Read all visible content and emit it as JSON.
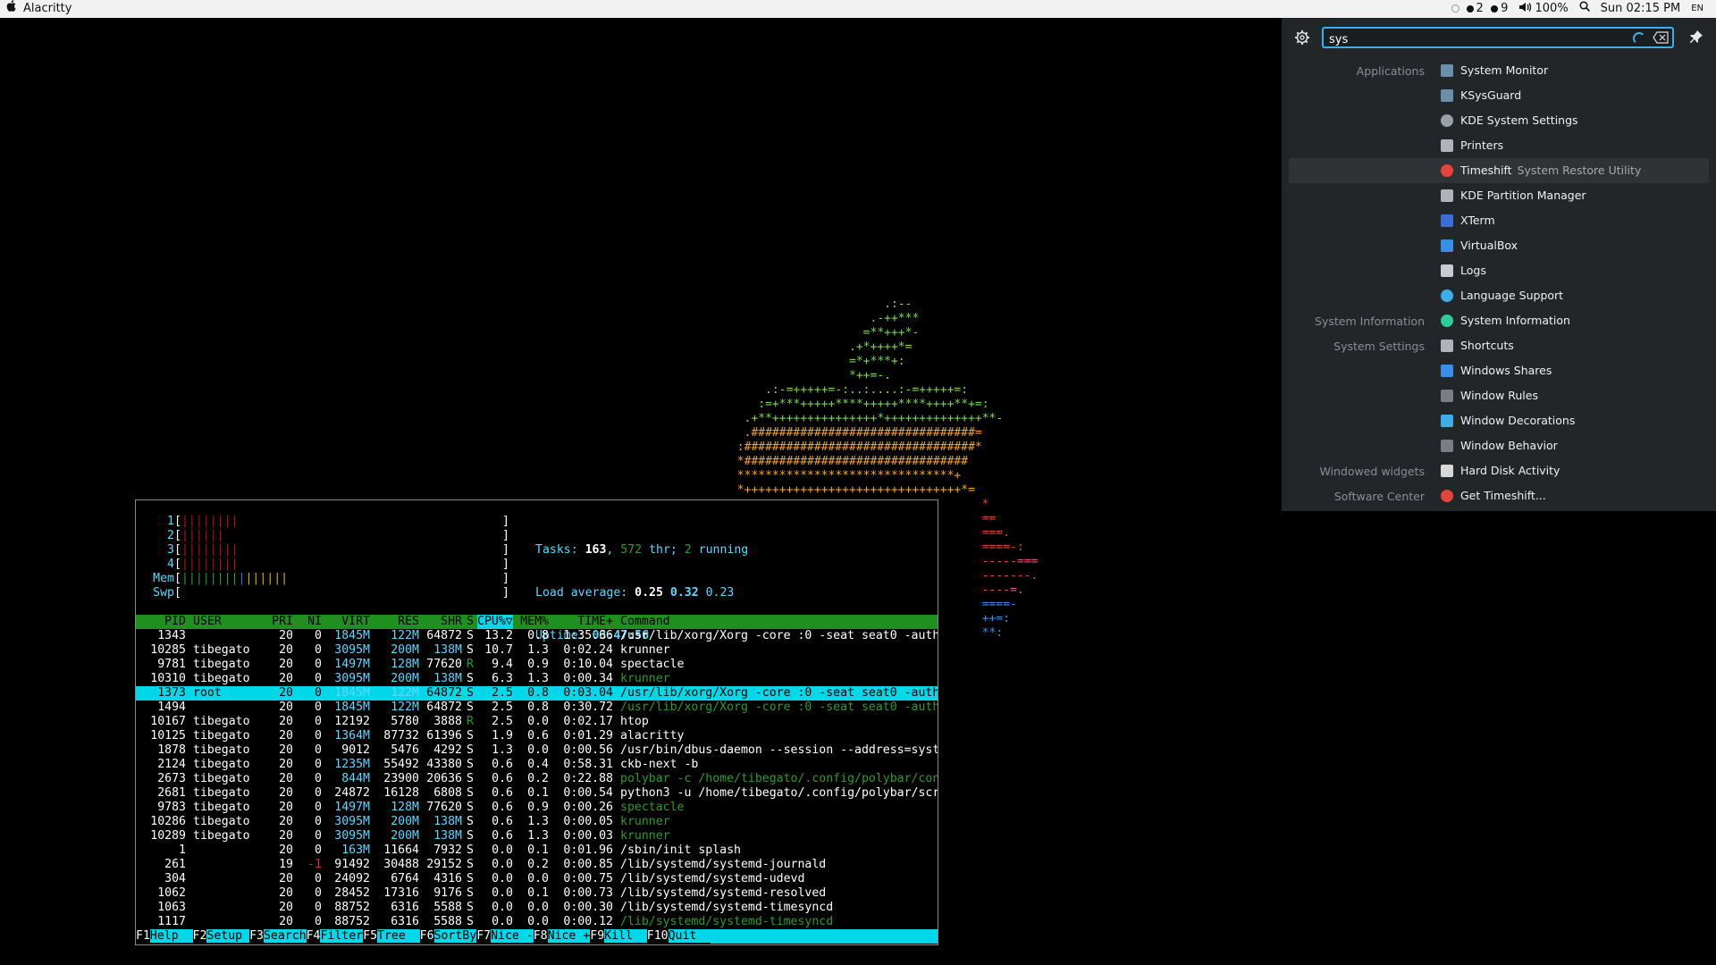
{
  "topbar": {
    "app_title": "Alacritty",
    "ws_a": "2",
    "ws_b": "9",
    "volume": "100%",
    "clock": "Sun 02:15 PM",
    "lang": "EN"
  },
  "htop": {
    "meters": [
      {
        "label": "1"
      },
      {
        "label": "2"
      },
      {
        "label": "3"
      },
      {
        "label": "4"
      },
      {
        "label": "Mem"
      },
      {
        "label": "Swp"
      }
    ],
    "summary": {
      "tasks_label": "Tasks: ",
      "tasks": "163",
      "thr_sep": ", ",
      "threads": "572",
      "thr_label": " thr; ",
      "running": "2",
      "running_label": " running",
      "load_label": "Load average: ",
      "load1": "0.25",
      "load5": "0.32",
      "load15": "0.23",
      "uptime_label": "Uptime: ",
      "uptime": "03:47:56"
    },
    "columns": [
      "PID",
      "USER",
      "PRI",
      "NI",
      "VIRT",
      "RES",
      "SHR",
      "S",
      "CPU%▽",
      "MEM%",
      "TIME+",
      "Command"
    ],
    "rows": [
      {
        "pid": "1343",
        "user": "",
        "pri": "20",
        "ni": "0",
        "virt": "1845M",
        "res": "122M",
        "shr": "64872",
        "s": "S",
        "cpu": "13.2",
        "mem": "0.8",
        "time": "1:35.66",
        "cmd": "/usr/lib/xorg/Xorg -core :0 -seat seat0 -auth /"
      },
      {
        "pid": "10285",
        "user": "tibegato",
        "pri": "20",
        "ni": "0",
        "virt": "3095M",
        "res": "200M",
        "shr": "138M",
        "s": "S",
        "cpu": "10.7",
        "mem": "1.3",
        "time": "0:02.24",
        "cmd": "krunner"
      },
      {
        "pid": "9781",
        "user": "tibegato",
        "pri": "20",
        "ni": "0",
        "virt": "1497M",
        "res": "128M",
        "shr": "77620",
        "s": "R",
        "cpu": "9.4",
        "mem": "0.9",
        "time": "0:10.04",
        "cmd": "spectacle"
      },
      {
        "pid": "10310",
        "user": "tibegato",
        "pri": "20",
        "ni": "0",
        "virt": "3095M",
        "res": "200M",
        "shr": "138M",
        "s": "S",
        "cpu": "6.3",
        "mem": "1.3",
        "time": "0:00.34",
        "cmd": "krunner"
      },
      {
        "pid": "1373",
        "user": "root",
        "pri": "20",
        "ni": "0",
        "virt": "1845M",
        "res": "122M",
        "shr": "64872",
        "s": "S",
        "cpu": "2.5",
        "mem": "0.8",
        "time": "0:03.04",
        "cmd": "/usr/lib/xorg/Xorg -core :0 -seat seat0 -auth /"
      },
      {
        "pid": "1494",
        "user": "",
        "pri": "20",
        "ni": "0",
        "virt": "1845M",
        "res": "122M",
        "shr": "64872",
        "s": "S",
        "cpu": "2.5",
        "mem": "0.8",
        "time": "0:30.72",
        "cmd": "/usr/lib/xorg/Xorg -core :0 -seat seat0 -auth /"
      },
      {
        "pid": "10167",
        "user": "tibegato",
        "pri": "20",
        "ni": "0",
        "virt": "12192",
        "res": "5780",
        "shr": "3888",
        "s": "R",
        "cpu": "2.5",
        "mem": "0.0",
        "time": "0:02.17",
        "cmd": "htop"
      },
      {
        "pid": "10125",
        "user": "tibegato",
        "pri": "20",
        "ni": "0",
        "virt": "1364M",
        "res": "87732",
        "shr": "61396",
        "s": "S",
        "cpu": "1.9",
        "mem": "0.6",
        "time": "0:01.29",
        "cmd": "alacritty"
      },
      {
        "pid": "1878",
        "user": "tibegato",
        "pri": "20",
        "ni": "0",
        "virt": "9012",
        "res": "5476",
        "shr": "4292",
        "s": "S",
        "cpu": "1.3",
        "mem": "0.0",
        "time": "0:00.56",
        "cmd": "/usr/bin/dbus-daemon --session --address=system"
      },
      {
        "pid": "2124",
        "user": "tibegato",
        "pri": "20",
        "ni": "0",
        "virt": "1235M",
        "res": "55492",
        "shr": "43380",
        "s": "S",
        "cpu": "0.6",
        "mem": "0.4",
        "time": "0:58.31",
        "cmd": "ckb-next -b"
      },
      {
        "pid": "2673",
        "user": "tibegato",
        "pri": "20",
        "ni": "0",
        "virt": "844M",
        "res": "23900",
        "shr": "20636",
        "s": "S",
        "cpu": "0.6",
        "mem": "0.2",
        "time": "0:22.88",
        "cmd": "polybar -c /home/tibegato/.config/polybar/confi"
      },
      {
        "pid": "2681",
        "user": "tibegato",
        "pri": "20",
        "ni": "0",
        "virt": "24872",
        "res": "16128",
        "shr": "6808",
        "s": "S",
        "cpu": "0.6",
        "mem": "0.1",
        "time": "0:00.54",
        "cmd": "python3 -u /home/tibegato/.config/polybar/scrip"
      },
      {
        "pid": "9783",
        "user": "tibegato",
        "pri": "20",
        "ni": "0",
        "virt": "1497M",
        "res": "128M",
        "shr": "77620",
        "s": "S",
        "cpu": "0.6",
        "mem": "0.9",
        "time": "0:00.26",
        "cmd": "spectacle"
      },
      {
        "pid": "10286",
        "user": "tibegato",
        "pri": "20",
        "ni": "0",
        "virt": "3095M",
        "res": "200M",
        "shr": "138M",
        "s": "S",
        "cpu": "0.6",
        "mem": "1.3",
        "time": "0:00.05",
        "cmd": "krunner"
      },
      {
        "pid": "10289",
        "user": "tibegato",
        "pri": "20",
        "ni": "0",
        "virt": "3095M",
        "res": "200M",
        "shr": "138M",
        "s": "S",
        "cpu": "0.6",
        "mem": "1.3",
        "time": "0:00.03",
        "cmd": "krunner"
      },
      {
        "pid": "1",
        "user": "",
        "pri": "20",
        "ni": "0",
        "virt": "163M",
        "res": "11664",
        "shr": "7932",
        "s": "S",
        "cpu": "0.0",
        "mem": "0.1",
        "time": "0:01.96",
        "cmd": "/sbin/init splash"
      },
      {
        "pid": "261",
        "user": "",
        "pri": "19",
        "ni": "-1",
        "virt": "91492",
        "res": "30488",
        "shr": "29152",
        "s": "S",
        "cpu": "0.0",
        "mem": "0.2",
        "time": "0:00.85",
        "cmd": "/lib/systemd/systemd-journald"
      },
      {
        "pid": "304",
        "user": "",
        "pri": "20",
        "ni": "0",
        "virt": "24092",
        "res": "6764",
        "shr": "4316",
        "s": "S",
        "cpu": "0.0",
        "mem": "0.0",
        "time": "0:00.75",
        "cmd": "/lib/systemd/systemd-udevd"
      },
      {
        "pid": "1062",
        "user": "",
        "pri": "20",
        "ni": "0",
        "virt": "28452",
        "res": "17316",
        "shr": "9176",
        "s": "S",
        "cpu": "0.0",
        "mem": "0.1",
        "time": "0:00.73",
        "cmd": "/lib/systemd/systemd-resolved"
      },
      {
        "pid": "1063",
        "user": "",
        "pri": "20",
        "ni": "0",
        "virt": "88752",
        "res": "6316",
        "shr": "5588",
        "s": "S",
        "cpu": "0.0",
        "mem": "0.0",
        "time": "0:00.30",
        "cmd": "/lib/systemd/systemd-timesyncd"
      },
      {
        "pid": "1117",
        "user": "",
        "pri": "20",
        "ni": "0",
        "virt": "88752",
        "res": "6316",
        "shr": "5588",
        "s": "S",
        "cpu": "0.0",
        "mem": "0.0",
        "time": "0:00.12",
        "cmd": "/lib/systemd/systemd-timesyncd"
      }
    ],
    "fkeys": [
      {
        "key": "F1",
        "label": "Help  "
      },
      {
        "key": "F2",
        "label": "Setup "
      },
      {
        "key": "F3",
        "label": "Search"
      },
      {
        "key": "F4",
        "label": "Filter"
      },
      {
        "key": "F5",
        "label": "Tree  "
      },
      {
        "key": "F6",
        "label": "SortBy"
      },
      {
        "key": "F7",
        "label": "Nice -"
      },
      {
        "key": "F8",
        "label": "Nice +"
      },
      {
        "key": "F9",
        "label": "Kill  "
      },
      {
        "key": "F10",
        "label": "Quit  "
      }
    ]
  },
  "krunner": {
    "query": "sys",
    "results": [
      {
        "category": "Applications",
        "label": "System Monitor",
        "sub": "",
        "icon_color": "#6b8fa8",
        "icon": "system-monitor-icon"
      },
      {
        "category": "",
        "label": "KSysGuard",
        "sub": "",
        "icon_color": "#6b8fa8",
        "icon": "ksysguard-icon"
      },
      {
        "category": "",
        "label": "KDE System Settings",
        "sub": "",
        "icon_color": "#9aa0a6",
        "icon": "kde-settings-icon"
      },
      {
        "category": "",
        "label": "Printers",
        "sub": "",
        "icon_color": "#b0b4b8",
        "icon": "printer-icon"
      },
      {
        "category": "",
        "label": "Timeshift",
        "sub": "System Restore Utility",
        "icon_color": "#e0463a",
        "icon": "timeshift-icon"
      },
      {
        "category": "",
        "label": "KDE Partition Manager",
        "sub": "",
        "icon_color": "#b0b4b8",
        "icon": "partition-manager-icon"
      },
      {
        "category": "",
        "label": "XTerm",
        "sub": "",
        "icon_color": "#3b6fd6",
        "icon": "xterm-icon"
      },
      {
        "category": "",
        "label": "VirtualBox",
        "sub": "",
        "icon_color": "#3b8ee8",
        "icon": "virtualbox-icon"
      },
      {
        "category": "",
        "label": "Logs",
        "sub": "",
        "icon_color": "#c8ccd0",
        "icon": "logs-icon"
      },
      {
        "category": "",
        "label": "Language Support",
        "sub": "",
        "icon_color": "#3daee9",
        "icon": "language-icon"
      },
      {
        "category": "System Information",
        "label": "System Information",
        "sub": "",
        "icon_color": "#2ecc9a",
        "icon": "system-info-icon"
      },
      {
        "category": "System Settings",
        "label": "Shortcuts",
        "sub": "",
        "icon_color": "#b0b4b8",
        "icon": "shortcuts-icon"
      },
      {
        "category": "",
        "label": "Windows Shares",
        "sub": "",
        "icon_color": "#3b8ee8",
        "icon": "windows-shares-icon"
      },
      {
        "category": "",
        "label": "Window Rules",
        "sub": "",
        "icon_color": "#7a7e82",
        "icon": "window-rules-icon"
      },
      {
        "category": "",
        "label": "Window Decorations",
        "sub": "",
        "icon_color": "#3daee9",
        "icon": "window-decorations-icon"
      },
      {
        "category": "",
        "label": "Window Behavior",
        "sub": "",
        "icon_color": "#7a7e82",
        "icon": "window-behavior-icon"
      },
      {
        "category": "Windowed widgets",
        "label": "Hard Disk Activity",
        "sub": "",
        "icon_color": "#d8d8d8",
        "icon": "hard-disk-icon"
      },
      {
        "category": "Software Center",
        "label": "Get Timeshift...",
        "sub": "",
        "icon_color": "#e0463a",
        "icon": "timeshift-icon"
      }
    ]
  }
}
